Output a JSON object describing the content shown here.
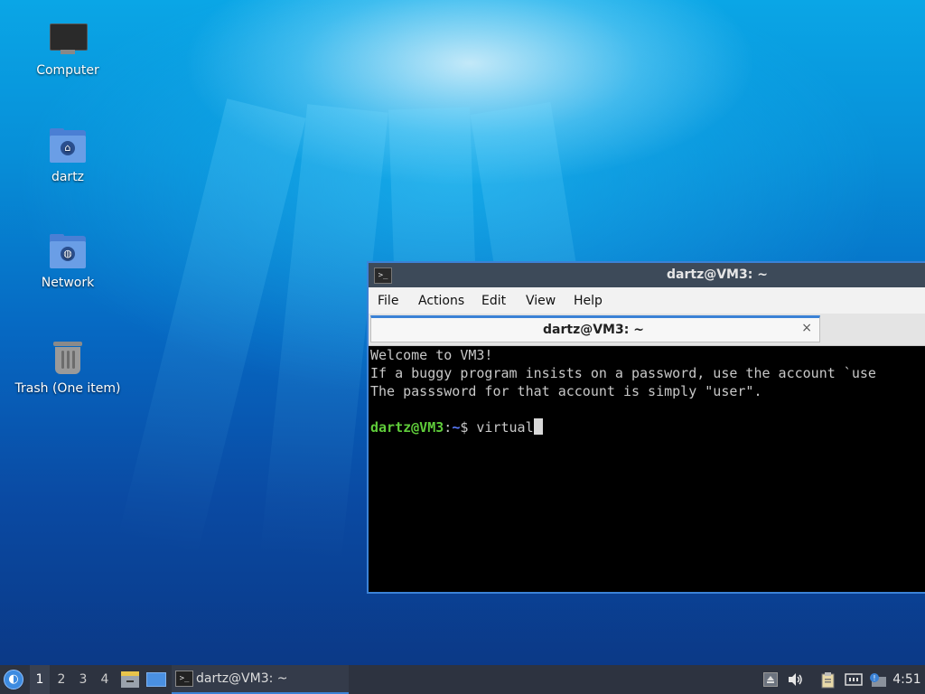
{
  "desktop": {
    "icons": [
      {
        "label": "Computer",
        "icon": "computer-icon"
      },
      {
        "label": "dartz",
        "icon": "home-folder-icon"
      },
      {
        "label": "Network",
        "icon": "network-folder-icon"
      },
      {
        "label": "Trash (One item)",
        "icon": "trash-icon"
      }
    ]
  },
  "terminal": {
    "title": "dartz@VM3: ~",
    "menu": [
      "File",
      "Actions",
      "Edit",
      "View",
      "Help"
    ],
    "tab_label": "dartz@VM3: ~",
    "tab_close": "×",
    "lines": [
      "Welcome to VM3!",
      "If a buggy program insists on a password, use the account `use",
      "The passsword for that account is simply \"user\"."
    ],
    "prompt_user": "dartz@VM3",
    "prompt_sep": ":",
    "prompt_path": "~",
    "prompt_symbol": "$ ",
    "command": "virtual"
  },
  "taskbar": {
    "workspaces": [
      "1",
      "2",
      "3",
      "4"
    ],
    "active_workspace": "1",
    "task_label": "dartz@VM3: ~",
    "clock": "4:51",
    "accent": "#3b82d6"
  }
}
